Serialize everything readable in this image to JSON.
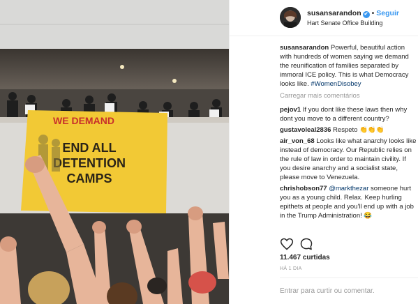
{
  "post": {
    "username": "susansarandon",
    "verified_mark": "✔",
    "separator": "•",
    "follow_label": "Seguir",
    "location": "Hart Senate Office Building"
  },
  "photo": {
    "banner_top": "WE DEMAND",
    "banner_line1": "END ALL",
    "banner_line2": "DETENTION",
    "banner_line3": "CAMPS",
    "banner_color": "#f2c935",
    "banner_text_color": "#2b2418",
    "banner_red": "#c8302b"
  },
  "caption": {
    "username": "susansarandon",
    "text": "Powerful, beautiful action with hundreds of women saying we demand the reunification of families separated by immoral ICE policy. This is what Democracy looks like.",
    "hashtag": "#WomenDisobey"
  },
  "load_more_label": "Carregar mais comentários",
  "comments": [
    {
      "username": "pejov1",
      "text": "If you dont like these laws then why dont you move to a different country?"
    },
    {
      "username": "gustavoleal2836",
      "text": "Respeto 👏👏👏"
    },
    {
      "username": "air_von_68",
      "text": "Looks like what anarchy looks like instead of democracy. Our Republic relies on the rule of law in order to maintain civility. If you desire anarchy and a socialist state, please move to Venezuela."
    },
    {
      "username": "chrishobson77",
      "mention": "@markthezar",
      "text": "someone hurt you as a young child. Relax. Keep hurling epithets at people and you'll end up with a job in the Trump Administration! 😂"
    }
  ],
  "actions": {
    "like_icon": "heart-icon",
    "comment_icon": "comment-bubble-icon"
  },
  "likes_label": "11.467 curtidas",
  "time_label": "HÁ 1 DIA",
  "add_comment_placeholder": "Entrar para curtir ou comentar.",
  "colors": {
    "link_blue": "#3897f0",
    "hashtag_blue": "#003569",
    "muted": "#999999",
    "border": "#efefef"
  }
}
